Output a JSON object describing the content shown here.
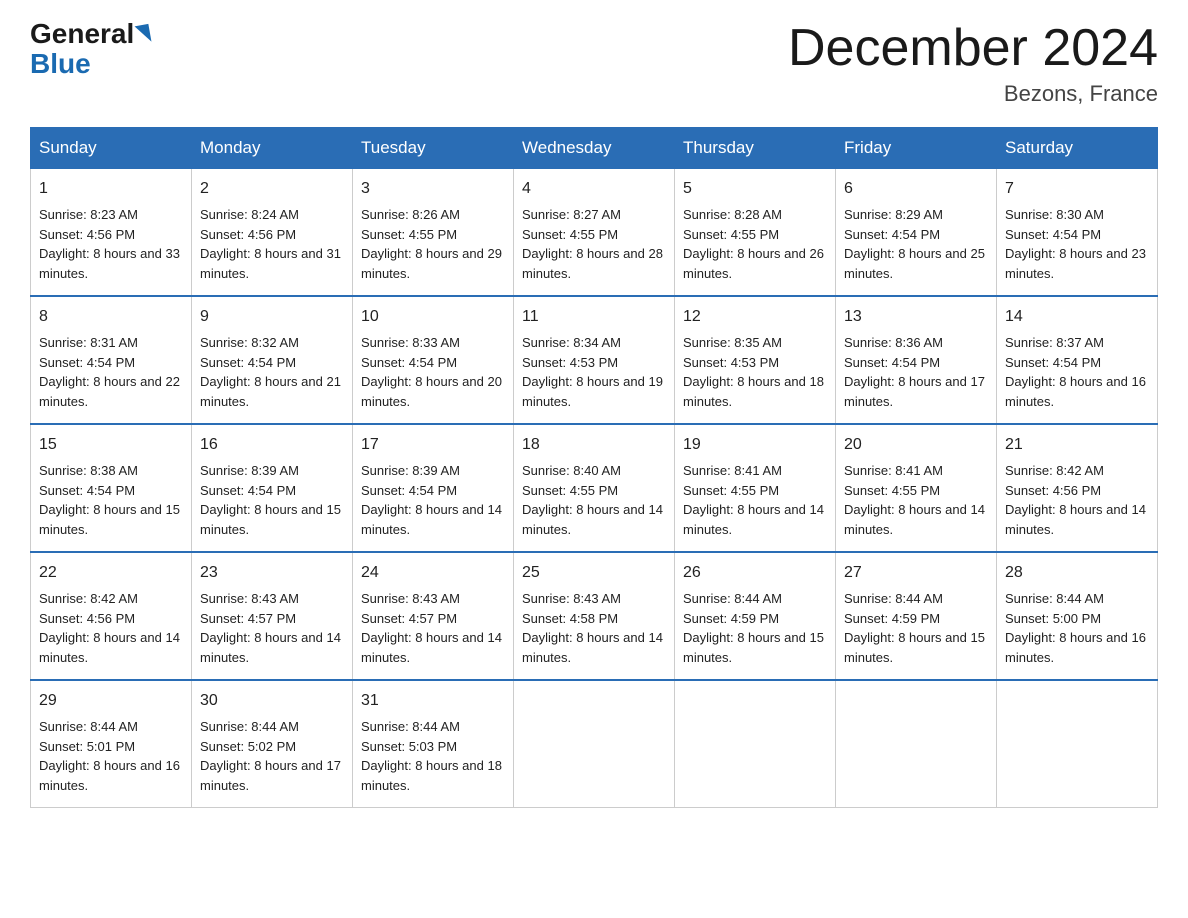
{
  "header": {
    "logo_general": "General",
    "logo_blue": "Blue",
    "title": "December 2024",
    "location": "Bezons, France"
  },
  "days_of_week": [
    "Sunday",
    "Monday",
    "Tuesday",
    "Wednesday",
    "Thursday",
    "Friday",
    "Saturday"
  ],
  "weeks": [
    [
      {
        "day": "1",
        "sunrise": "8:23 AM",
        "sunset": "4:56 PM",
        "daylight": "8 hours and 33 minutes."
      },
      {
        "day": "2",
        "sunrise": "8:24 AM",
        "sunset": "4:56 PM",
        "daylight": "8 hours and 31 minutes."
      },
      {
        "day": "3",
        "sunrise": "8:26 AM",
        "sunset": "4:55 PM",
        "daylight": "8 hours and 29 minutes."
      },
      {
        "day": "4",
        "sunrise": "8:27 AM",
        "sunset": "4:55 PM",
        "daylight": "8 hours and 28 minutes."
      },
      {
        "day": "5",
        "sunrise": "8:28 AM",
        "sunset": "4:55 PM",
        "daylight": "8 hours and 26 minutes."
      },
      {
        "day": "6",
        "sunrise": "8:29 AM",
        "sunset": "4:54 PM",
        "daylight": "8 hours and 25 minutes."
      },
      {
        "day": "7",
        "sunrise": "8:30 AM",
        "sunset": "4:54 PM",
        "daylight": "8 hours and 23 minutes."
      }
    ],
    [
      {
        "day": "8",
        "sunrise": "8:31 AM",
        "sunset": "4:54 PM",
        "daylight": "8 hours and 22 minutes."
      },
      {
        "day": "9",
        "sunrise": "8:32 AM",
        "sunset": "4:54 PM",
        "daylight": "8 hours and 21 minutes."
      },
      {
        "day": "10",
        "sunrise": "8:33 AM",
        "sunset": "4:54 PM",
        "daylight": "8 hours and 20 minutes."
      },
      {
        "day": "11",
        "sunrise": "8:34 AM",
        "sunset": "4:53 PM",
        "daylight": "8 hours and 19 minutes."
      },
      {
        "day": "12",
        "sunrise": "8:35 AM",
        "sunset": "4:53 PM",
        "daylight": "8 hours and 18 minutes."
      },
      {
        "day": "13",
        "sunrise": "8:36 AM",
        "sunset": "4:54 PM",
        "daylight": "8 hours and 17 minutes."
      },
      {
        "day": "14",
        "sunrise": "8:37 AM",
        "sunset": "4:54 PM",
        "daylight": "8 hours and 16 minutes."
      }
    ],
    [
      {
        "day": "15",
        "sunrise": "8:38 AM",
        "sunset": "4:54 PM",
        "daylight": "8 hours and 15 minutes."
      },
      {
        "day": "16",
        "sunrise": "8:39 AM",
        "sunset": "4:54 PM",
        "daylight": "8 hours and 15 minutes."
      },
      {
        "day": "17",
        "sunrise": "8:39 AM",
        "sunset": "4:54 PM",
        "daylight": "8 hours and 14 minutes."
      },
      {
        "day": "18",
        "sunrise": "8:40 AM",
        "sunset": "4:55 PM",
        "daylight": "8 hours and 14 minutes."
      },
      {
        "day": "19",
        "sunrise": "8:41 AM",
        "sunset": "4:55 PM",
        "daylight": "8 hours and 14 minutes."
      },
      {
        "day": "20",
        "sunrise": "8:41 AM",
        "sunset": "4:55 PM",
        "daylight": "8 hours and 14 minutes."
      },
      {
        "day": "21",
        "sunrise": "8:42 AM",
        "sunset": "4:56 PM",
        "daylight": "8 hours and 14 minutes."
      }
    ],
    [
      {
        "day": "22",
        "sunrise": "8:42 AM",
        "sunset": "4:56 PM",
        "daylight": "8 hours and 14 minutes."
      },
      {
        "day": "23",
        "sunrise": "8:43 AM",
        "sunset": "4:57 PM",
        "daylight": "8 hours and 14 minutes."
      },
      {
        "day": "24",
        "sunrise": "8:43 AM",
        "sunset": "4:57 PM",
        "daylight": "8 hours and 14 minutes."
      },
      {
        "day": "25",
        "sunrise": "8:43 AM",
        "sunset": "4:58 PM",
        "daylight": "8 hours and 14 minutes."
      },
      {
        "day": "26",
        "sunrise": "8:44 AM",
        "sunset": "4:59 PM",
        "daylight": "8 hours and 15 minutes."
      },
      {
        "day": "27",
        "sunrise": "8:44 AM",
        "sunset": "4:59 PM",
        "daylight": "8 hours and 15 minutes."
      },
      {
        "day": "28",
        "sunrise": "8:44 AM",
        "sunset": "5:00 PM",
        "daylight": "8 hours and 16 minutes."
      }
    ],
    [
      {
        "day": "29",
        "sunrise": "8:44 AM",
        "sunset": "5:01 PM",
        "daylight": "8 hours and 16 minutes."
      },
      {
        "day": "30",
        "sunrise": "8:44 AM",
        "sunset": "5:02 PM",
        "daylight": "8 hours and 17 minutes."
      },
      {
        "day": "31",
        "sunrise": "8:44 AM",
        "sunset": "5:03 PM",
        "daylight": "8 hours and 18 minutes."
      },
      null,
      null,
      null,
      null
    ]
  ],
  "labels": {
    "sunrise": "Sunrise:",
    "sunset": "Sunset:",
    "daylight": "Daylight:"
  }
}
